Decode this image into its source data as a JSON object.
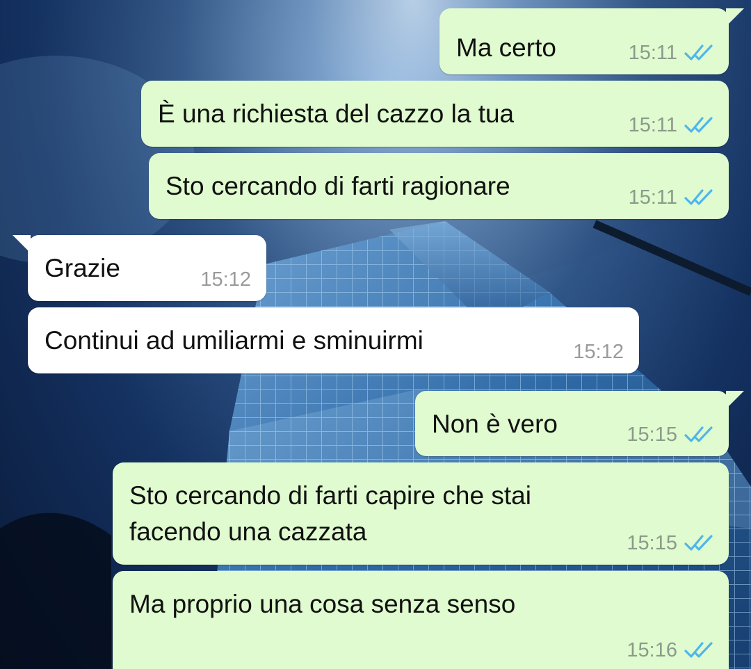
{
  "conversation": {
    "messages": [
      {
        "direction": "outgoing",
        "text": "Ma certo",
        "time": "15:11",
        "status": "read"
      },
      {
        "direction": "outgoing",
        "text": "È una richiesta del cazzo la tua",
        "time": "15:11",
        "status": "read"
      },
      {
        "direction": "outgoing",
        "text": "Sto cercando di farti ragionare",
        "time": "15:11",
        "status": "read"
      },
      {
        "direction": "incoming",
        "text": "Grazie",
        "time": "15:12"
      },
      {
        "direction": "incoming",
        "text": "Continui ad umiliarmi e sminuirmi",
        "time": "15:12"
      },
      {
        "direction": "outgoing",
        "text": "Non è vero",
        "time": "15:15",
        "status": "read"
      },
      {
        "direction": "outgoing",
        "text": "Sto cercando di farti capire che stai\nfacendo una cazzata",
        "time": "15:15",
        "status": "read"
      },
      {
        "direction": "outgoing",
        "text": "Ma proprio una cosa senza senso",
        "time": "15:16",
        "status": "read"
      }
    ]
  },
  "colors": {
    "outgoing_bubble": "#e0fbcf",
    "incoming_bubble": "#ffffff",
    "read_ticks": "#4fb6ec",
    "timestamp": "#8b9a8a"
  },
  "icons": {
    "read_status": "double-check-icon"
  }
}
